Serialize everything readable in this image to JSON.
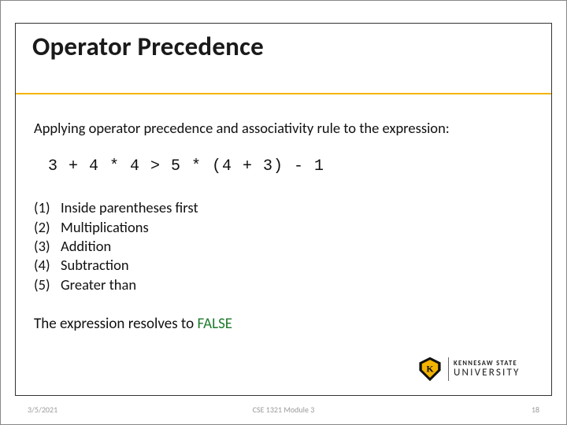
{
  "title": "Operator Precedence",
  "intro": "Applying operator precedence and associativity rule to the expression:",
  "expression": "3 + 4 * 4 > 5 * (4 + 3) - 1",
  "steps": [
    {
      "n": "(1)",
      "text": "Inside parentheses first"
    },
    {
      "n": "(2)",
      "text": "Multiplications"
    },
    {
      "n": "(3)",
      "text": "Addition"
    },
    {
      "n": "(4)",
      "text": "Subtraction"
    },
    {
      "n": "(5)",
      "text": "Greater than"
    }
  ],
  "resolve_prefix": "The expression resolves to ",
  "resolve_value": "FALSE",
  "footer": {
    "left": "3/5/2021",
    "center": "CSE 1321 Module 3",
    "right": "18"
  },
  "logo": {
    "top": "KENNESAW STATE",
    "bottom": "UNIVERSITY"
  }
}
